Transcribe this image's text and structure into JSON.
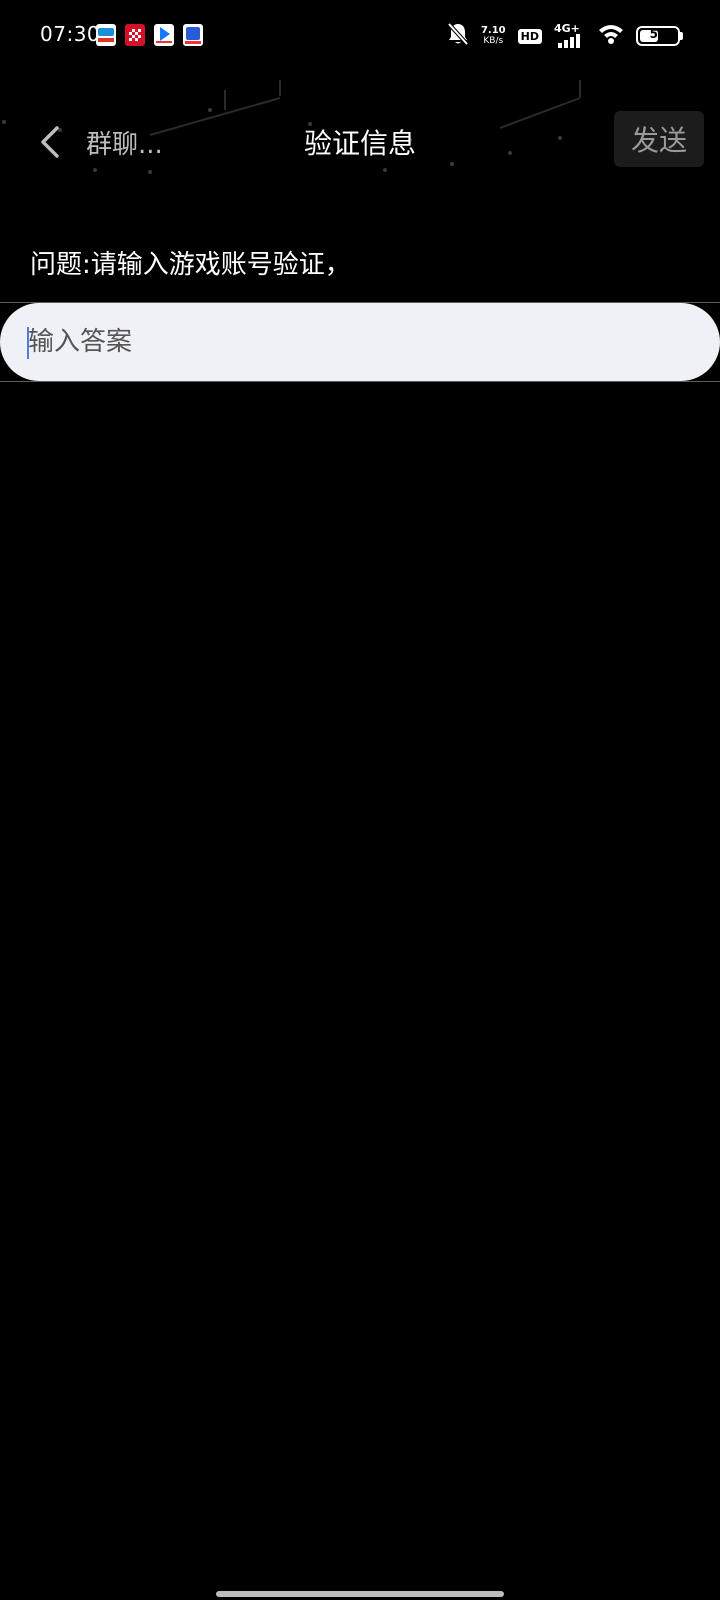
{
  "status_bar": {
    "time": "07:30",
    "notification_icons": [
      "app-a-icon",
      "app-b-icon",
      "app-c-icon",
      "app-d-icon"
    ],
    "net_speed_value": "7.10",
    "net_speed_unit": "KB/s",
    "hd": "HD",
    "network": "4G+",
    "battery": "51",
    "battery_level": 0.51
  },
  "header": {
    "back_label": "群聊...",
    "title": "验证信息",
    "send_label": "发送"
  },
  "question": {
    "text": "问题:请输入游戏账号验证，"
  },
  "answer": {
    "value": "",
    "placeholder": "输入答案"
  },
  "colors": {
    "background": "#000000",
    "input_bg": "#f0f1f6",
    "send_bg": "#1c1c1c",
    "muted_text": "#9a9a9a",
    "caret": "#4a7fe0"
  }
}
